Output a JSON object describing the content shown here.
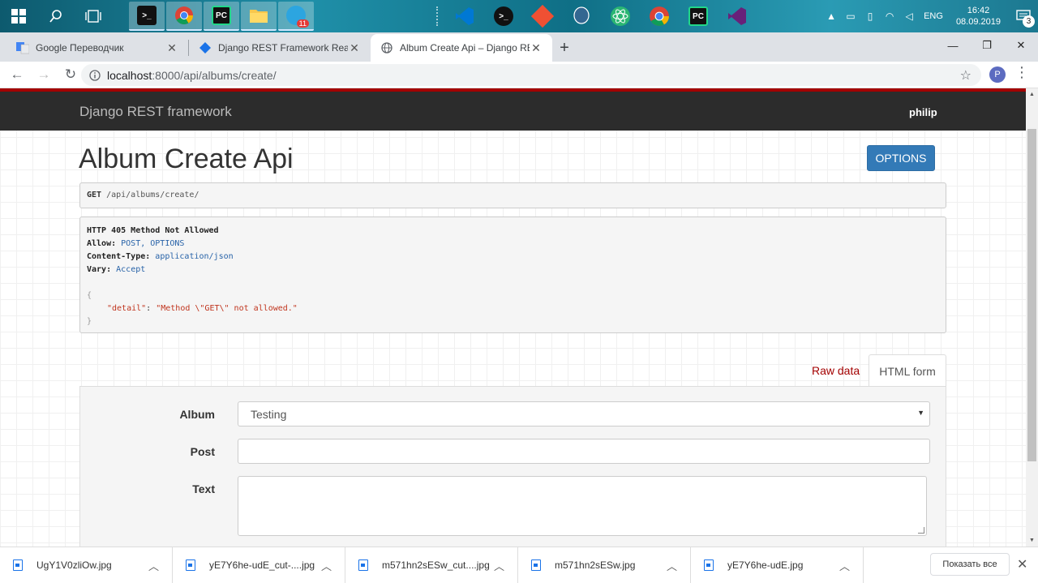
{
  "taskbar": {
    "apps": [
      {
        "name": "terminal",
        "label": ">_"
      },
      {
        "name": "chrome",
        "label": ""
      },
      {
        "name": "pycharm",
        "label": "PC"
      },
      {
        "name": "explorer",
        "label": ""
      },
      {
        "name": "telegram",
        "label": "11"
      }
    ],
    "pinned": [
      {
        "name": "vscode",
        "label": ""
      },
      {
        "name": "terminal2",
        "label": ">_"
      },
      {
        "name": "git",
        "label": ""
      },
      {
        "name": "postgres",
        "label": ""
      },
      {
        "name": "atom",
        "label": ""
      },
      {
        "name": "chrome2",
        "label": ""
      },
      {
        "name": "pycharm2",
        "label": "PC"
      },
      {
        "name": "visual-studio",
        "label": ""
      }
    ],
    "language": "ENG",
    "time": "16:42",
    "date": "08.09.2019",
    "notifications": "3",
    "colors": {
      "chrome_red": "#db4437",
      "chrome_green": "#0f9d58",
      "chrome_yellow": "#f4b400",
      "chrome_blue": "#4285f4",
      "pycharm": "#21d789",
      "vscode": "#0078d4",
      "git": "#f05033",
      "vs": "#68217a"
    }
  },
  "browser": {
    "tabs": [
      {
        "title": "Google Переводчик",
        "active": false
      },
      {
        "title": "Django REST Framework Read &",
        "active": false
      },
      {
        "title": "Album Create Api – Django REST",
        "active": true
      }
    ],
    "url_host": "localhost",
    "url_rest": ":8000/api/albums/create/",
    "profile_initial": "P"
  },
  "navbar": {
    "brand": "Django REST framework",
    "user": "philip"
  },
  "page": {
    "title": "Album Create Api",
    "options_label": "OPTIONS",
    "request_method": "GET",
    "request_path": " /api/albums/create/",
    "response": {
      "status": "HTTP 405 Method Not Allowed",
      "headers": [
        {
          "key": "Allow:",
          "value": " POST, OPTIONS"
        },
        {
          "key": "Content-Type:",
          "value": " application/json"
        },
        {
          "key": "Vary:",
          "value": " Accept"
        }
      ],
      "open_brace": "{",
      "json_key": "\"detail\"",
      "json_sep": ": ",
      "json_value": "\"Method \\\"GET\\\" not allowed.\"",
      "close_brace": "}"
    },
    "tabs": {
      "raw": "Raw data",
      "html": "HTML form"
    },
    "form": {
      "album_label": "Album",
      "album_value": "Testing",
      "post_label": "Post",
      "post_value": "",
      "text_label": "Text"
    }
  },
  "downloads": {
    "items": [
      {
        "name": "UgY1V0zliOw.jpg"
      },
      {
        "name": "yE7Y6he-udE_cut-....jpg"
      },
      {
        "name": "m571hn2sESw_cut....jpg"
      },
      {
        "name": "m571hn2sESw.jpg"
      },
      {
        "name": "yE7Y6he-udE.jpg"
      }
    ],
    "show_all": "Показать все"
  },
  "colors": {
    "accent": "#a30000",
    "button": "#337ab7",
    "navbar": "#2c2c2c"
  }
}
